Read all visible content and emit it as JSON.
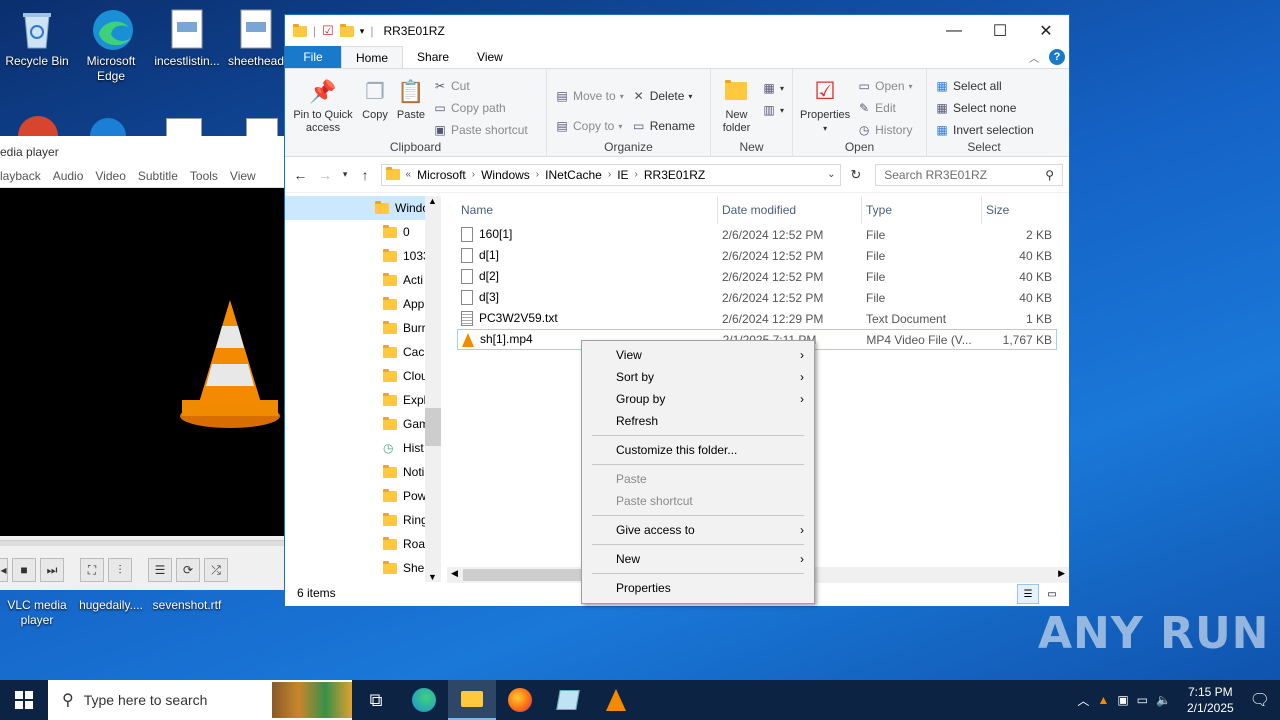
{
  "desktop": {
    "icons_top": [
      {
        "label": "Recycle Bin"
      },
      {
        "label": "Microsoft Edge"
      },
      {
        "label": "incestlistin..."
      },
      {
        "label": "sheethead"
      }
    ],
    "icons_bottom": [
      {
        "label": "VLC media player"
      },
      {
        "label": "hugedaily...."
      },
      {
        "label": "sevenshot.rtf"
      }
    ]
  },
  "vlc": {
    "title": "edia player",
    "menu": [
      "layback",
      "Audio",
      "Video",
      "Subtitle",
      "Tools",
      "View"
    ]
  },
  "explorer": {
    "title": "RR3E01RZ",
    "tabs": {
      "file": "File",
      "home": "Home",
      "share": "Share",
      "view": "View"
    },
    "ribbon": {
      "clipboard": {
        "name": "Clipboard",
        "pin": "Pin to Quick access",
        "copy": "Copy",
        "paste": "Paste",
        "cut": "Cut",
        "copy_path": "Copy path",
        "paste_shortcut": "Paste shortcut"
      },
      "organize": {
        "name": "Organize",
        "move_to": "Move to",
        "copy_to": "Copy to",
        "delete": "Delete",
        "rename": "Rename"
      },
      "new": {
        "name": "New",
        "new_folder": "New folder"
      },
      "open": {
        "name": "Open",
        "properties": "Properties",
        "open": "Open",
        "edit": "Edit",
        "history": "History"
      },
      "select": {
        "name": "Select",
        "select_all": "Select all",
        "select_none": "Select none",
        "invert": "Invert selection"
      }
    },
    "address": {
      "prefix": "«",
      "segments": [
        "Microsoft",
        "Windows",
        "INetCache",
        "IE",
        "RR3E01RZ"
      ]
    },
    "search_placeholder": "Search RR3E01RZ",
    "nav_items": [
      {
        "label": "Windo",
        "sel": true
      },
      {
        "label": "0"
      },
      {
        "label": "1033"
      },
      {
        "label": "Acti"
      },
      {
        "label": "App"
      },
      {
        "label": "Burr"
      },
      {
        "label": "Cach"
      },
      {
        "label": "Clou"
      },
      {
        "label": "Expl"
      },
      {
        "label": "Gam"
      },
      {
        "label": "Hist"
      },
      {
        "label": "Noti"
      },
      {
        "label": "Pow"
      },
      {
        "label": "Ring"
      },
      {
        "label": "Roar"
      },
      {
        "label": "Shel"
      }
    ],
    "columns": {
      "name": "Name",
      "date": "Date modified",
      "type": "Type",
      "size": "Size"
    },
    "files": [
      {
        "name": "160[1]",
        "date": "2/6/2024 12:52 PM",
        "type": "File",
        "size": "2 KB"
      },
      {
        "name": "d[1]",
        "date": "2/6/2024 12:52 PM",
        "type": "File",
        "size": "40 KB"
      },
      {
        "name": "d[2]",
        "date": "2/6/2024 12:52 PM",
        "type": "File",
        "size": "40 KB"
      },
      {
        "name": "d[3]",
        "date": "2/6/2024 12:52 PM",
        "type": "File",
        "size": "40 KB"
      },
      {
        "name": "PC3W2V59.txt",
        "date": "2/6/2024 12:29 PM",
        "type": "Text Document",
        "size": "1 KB"
      },
      {
        "name": "sh[1].mp4",
        "date": "2/1/2025 7:11 PM",
        "type": "MP4 Video File (V...",
        "size": "1,767 KB"
      }
    ],
    "status": "6 items"
  },
  "context_menu": {
    "view": "View",
    "sort_by": "Sort by",
    "group_by": "Group by",
    "refresh": "Refresh",
    "customize": "Customize this folder...",
    "paste": "Paste",
    "paste_shortcut": "Paste shortcut",
    "give_access": "Give access to",
    "new": "New",
    "properties": "Properties"
  },
  "taskbar": {
    "search_placeholder": "Type here to search",
    "time": "7:15 PM",
    "date": "2/1/2025"
  },
  "watermark": "ANY RUN"
}
